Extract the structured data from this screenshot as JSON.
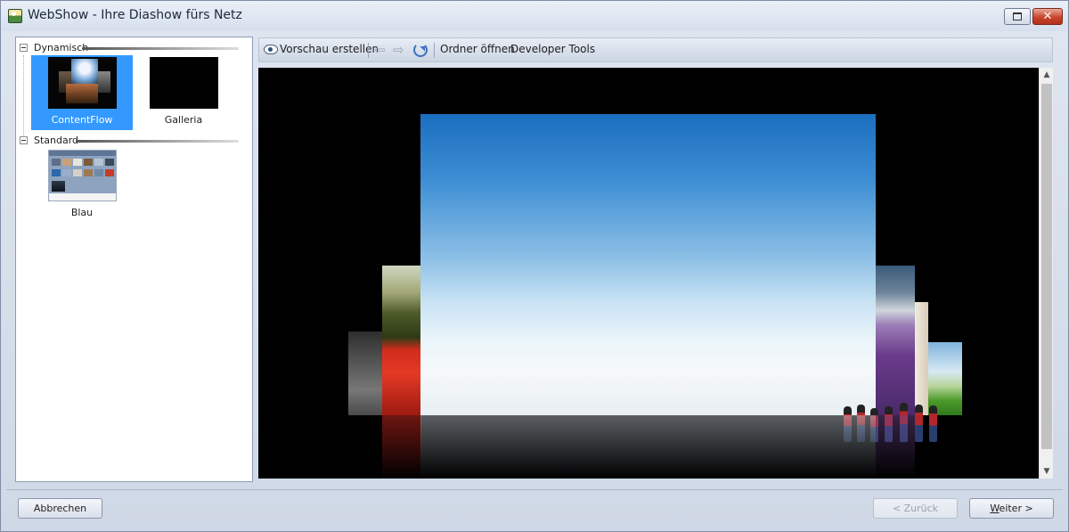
{
  "window": {
    "title": "WebShow - Ihre Diashow fürs Netz",
    "icons": {
      "app": "webshow-app-icon",
      "restore": "restore-icon",
      "close": "close-icon"
    },
    "close_glyph": "✕"
  },
  "tree": {
    "groups": [
      {
        "label": "Dynamisch",
        "items": [
          {
            "label": "ContentFlow",
            "selected": true
          },
          {
            "label": "Galleria",
            "selected": false
          }
        ]
      },
      {
        "label": "Standard",
        "items": [
          {
            "label": "Blau",
            "selected": false
          }
        ]
      }
    ]
  },
  "toolbar": {
    "preview_label": "Vorschau erstellen",
    "open_folder_label": "Ordner öffnen",
    "dev_tools_label": "Developer Tools",
    "icons": {
      "preview": "eye-icon",
      "back": "arrow-left-icon",
      "forward": "arrow-right-icon",
      "refresh": "refresh-icon"
    },
    "back_glyph": "⇦",
    "forward_glyph": "⇨"
  },
  "scrollbar": {
    "up_glyph": "▲",
    "down_glyph": "▼"
  },
  "footer": {
    "cancel_label": "Abbrechen",
    "back_label": "< Zurück",
    "next_label_mnemonic": "W",
    "next_label_rest": "eiter >"
  },
  "colors": {
    "selection": "#3399ff",
    "viewport_bg": "#000000",
    "close_button": "#c9452c"
  }
}
